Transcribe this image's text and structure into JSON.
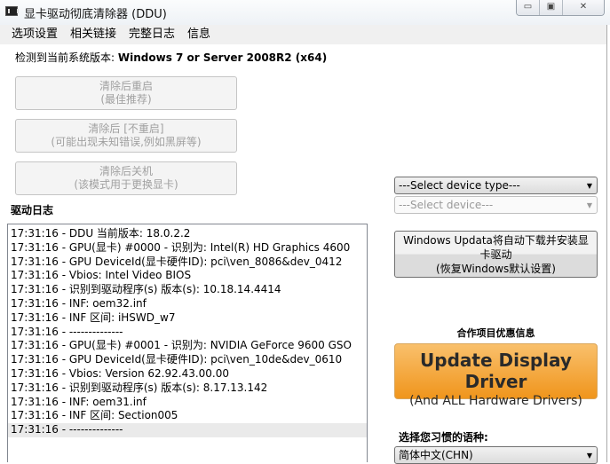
{
  "window": {
    "title": "显卡驱动彻底清除器 (DDU)",
    "minimize": "▭",
    "maximize": "▣",
    "close": "✕"
  },
  "menu": [
    "选项设置",
    "相关链接",
    "完整日志",
    "信息"
  ],
  "system": {
    "label": "检测到当前系统版本:",
    "value": "Windows 7 or Server 2008R2 (x64)"
  },
  "buttons": [
    {
      "line1": "清除后重启",
      "line2": "(最佳推荐)"
    },
    {
      "line1": "清除后 [不重启]",
      "line2": "(可能出现未知错误,例如黑屏等)"
    },
    {
      "line1": "清除后关机",
      "line2": "(该模式用于更换显卡)"
    }
  ],
  "log": {
    "label": "驱动日志",
    "lines": [
      "17:31:16 - DDU 当前版本: 18.0.2.2",
      "17:31:16 - GPU(显卡) #0000 - 识别为: Intel(R) HD Graphics 4600",
      "17:31:16 - GPU DeviceId(显卡硬件ID): pci\\ven_8086&dev_0412",
      "17:31:16 - Vbios: Intel Video BIOS",
      "17:31:16 - 识别到驱动程序(s) 版本(s): 10.18.14.4414",
      "17:31:16 - INF: oem32.inf",
      "17:31:16 - INF 区间: iHSWD_w7",
      "17:31:16 - --------------",
      "17:31:16 - GPU(显卡) #0001 - 识别为: NVIDIA GeForce 9600 GSO",
      "17:31:16 - GPU DeviceId(显卡硬件ID): pci\\ven_10de&dev_0610",
      "17:31:16 - Vbios: Version 62.92.43.00.00",
      "17:31:16 - 识别到驱动程序(s) 版本(s): 8.17.13.142",
      "17:31:16 - INF: oem31.inf",
      "17:31:16 - INF 区间: Section005",
      "17:31:16 - --------------"
    ]
  },
  "device_type": "---Select device type---",
  "device": "---Select device---",
  "windows_update": {
    "line1": "Windows Updata将自动下载并安装显",
    "line2": "卡驱动",
    "line3": "(恢复Windows默认设置)"
  },
  "partner": {
    "label": "合作项目优惠信息",
    "title": "Update Display Driver",
    "subtitle": "(And ALL Hardware Drivers)"
  },
  "language": {
    "label": "选择您习惯的语种:",
    "value": "简体中文(CHN)"
  }
}
